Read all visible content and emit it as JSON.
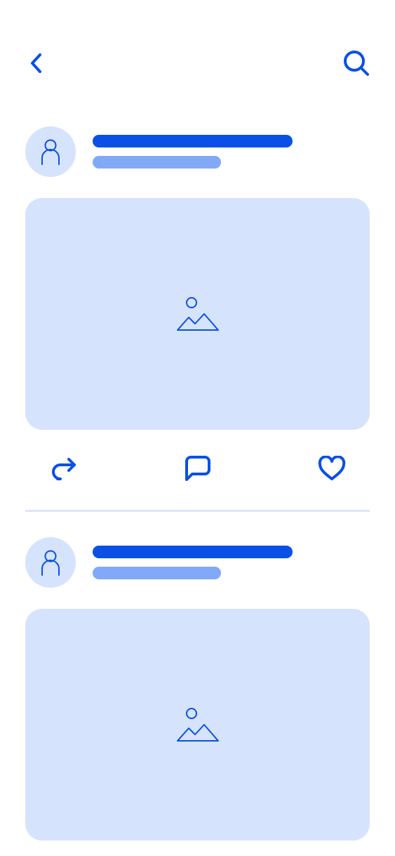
{
  "colors": {
    "accent": "#0a50e6",
    "accent_light": "#82a8f8",
    "surface": "#d6e3fd",
    "divider": "#dbe5f7"
  },
  "header": {
    "back_icon": "chevron-left-icon",
    "search_icon": "search-icon"
  },
  "posts": [
    {
      "avatar_icon": "user-icon",
      "media_icon": "image-icon"
    },
    {
      "avatar_icon": "user-icon",
      "media_icon": "image-icon"
    }
  ],
  "actions": [
    {
      "icon": "share-icon"
    },
    {
      "icon": "comment-icon"
    },
    {
      "icon": "heart-icon"
    }
  ]
}
